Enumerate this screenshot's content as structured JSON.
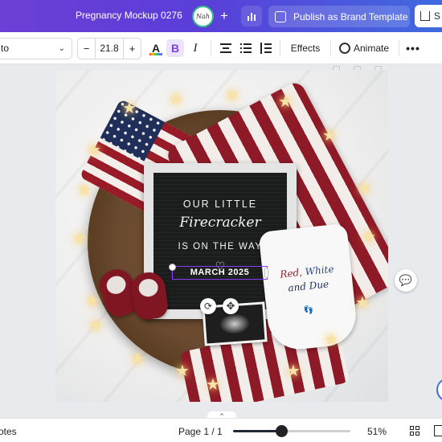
{
  "topbar": {
    "doc_title": "Pregnancy Mockup 0276",
    "avatar_text": "Nah",
    "plus": "+",
    "publish_label": "Publish as Brand Template",
    "share_label": "S"
  },
  "toolbar": {
    "font_name": "to",
    "font_size": "21.8",
    "minus": "−",
    "plus": "+",
    "text_color": "A",
    "bold": "B",
    "italic": "I",
    "effects_label": "Effects",
    "animate_label": "Animate",
    "more": "•••"
  },
  "design": {
    "board_line1": "OUR LITTLE",
    "board_line2": "Firecracker",
    "board_line3": "IS ON THE WAY",
    "board_heart": "♡",
    "selected_text": "MARCH 2025",
    "onesie_red": "Red, ",
    "onesie_white": "White",
    "onesie_line2": "and Due",
    "onesie_feet": "👣"
  },
  "footer": {
    "notes_label": "otes",
    "page_indicator": "Page 1 / 1",
    "zoom_label": "51%",
    "zoom_level": 0.41
  },
  "colors": {
    "accent": "#8b3dff",
    "topbar_start": "#6c3fd6",
    "topbar_end": "#3f6ae0"
  }
}
